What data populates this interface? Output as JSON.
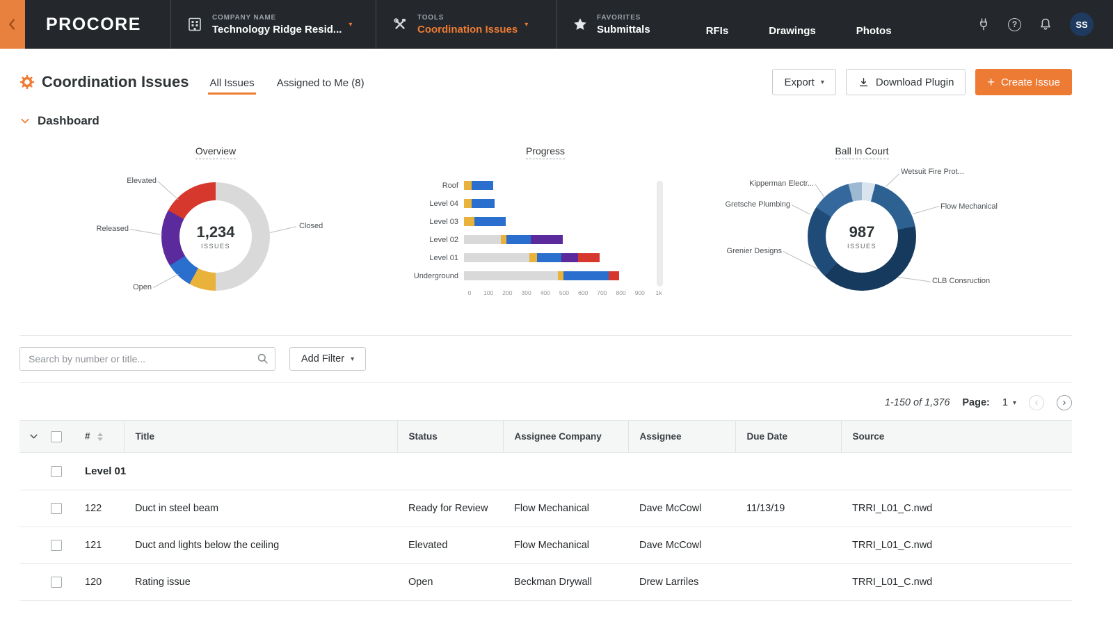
{
  "navbar": {
    "logo": "PROCORE",
    "company": {
      "label": "COMPANY NAME",
      "value": "Technology Ridge Resid..."
    },
    "tools": {
      "label": "TOOLS",
      "value": "Coordination Issues"
    },
    "favorites": {
      "label": "FAVORITES",
      "value": "Submittals"
    },
    "links": [
      "RFIs",
      "Drawings",
      "Photos"
    ],
    "avatar": "SS"
  },
  "header": {
    "title": "Coordination Issues",
    "tabs": {
      "all": "All Issues",
      "assigned": "Assigned to Me (8)"
    },
    "export_label": "Export",
    "download_label": "Download Plugin",
    "create_plus": "+",
    "create_label": "Create Issue"
  },
  "dashboard": {
    "label": "Dashboard",
    "overview": {
      "title": "Overview",
      "total": "1,234",
      "unit": "ISSUES",
      "segments": [
        {
          "color": "#d9d9d9",
          "value": 50
        },
        {
          "color": "#e9b23b",
          "value": 8
        },
        {
          "color": "#2a6fce",
          "value": 8
        },
        {
          "color": "#5b2a9d",
          "value": 17
        },
        {
          "color": "#d6382e",
          "value": 17
        }
      ],
      "callouts": {
        "elevated": "Elevated",
        "released": "Released",
        "open": "Open",
        "closed": "Closed"
      }
    },
    "progress": {
      "title": "Progress",
      "max": 1000,
      "rows": [
        {
          "label": "Roof",
          "segments": [
            {
              "color": "#e9b23b",
              "value": 40
            },
            {
              "color": "#2a6fce",
              "value": 115
            }
          ]
        },
        {
          "label": "Level 04",
          "segments": [
            {
              "color": "#e9b23b",
              "value": 40
            },
            {
              "color": "#2a6fce",
              "value": 120
            }
          ]
        },
        {
          "label": "Level 03",
          "segments": [
            {
              "color": "#e9b23b",
              "value": 55
            },
            {
              "color": "#2a6fce",
              "value": 165
            }
          ]
        },
        {
          "label": "Level 02",
          "segments": [
            {
              "color": "#d9d9d9",
              "value": 195
            },
            {
              "color": "#e9b23b",
              "value": 30
            },
            {
              "color": "#2a6fce",
              "value": 130
            },
            {
              "color": "#5b2a9d",
              "value": 170
            }
          ]
        },
        {
          "label": "Level 01",
          "segments": [
            {
              "color": "#d9d9d9",
              "value": 345
            },
            {
              "color": "#e9b23b",
              "value": 40
            },
            {
              "color": "#2a6fce",
              "value": 130
            },
            {
              "color": "#5b2a9d",
              "value": 90
            },
            {
              "color": "#d6382e",
              "value": 115
            }
          ]
        },
        {
          "label": "Underground",
          "segments": [
            {
              "color": "#d9d9d9",
              "value": 495
            },
            {
              "color": "#e9b23b",
              "value": 30
            },
            {
              "color": "#2a6fce",
              "value": 240
            },
            {
              "color": "#d6382e",
              "value": 55
            }
          ]
        }
      ],
      "ticks": [
        "0",
        "100",
        "200",
        "300",
        "400",
        "500",
        "600",
        "700",
        "800",
        "900",
        "1k"
      ]
    },
    "ball": {
      "title": "Ball In Court",
      "total": "987",
      "unit": "ISSUES",
      "segments": [
        {
          "color": "#d9e4ee",
          "value": 4
        },
        {
          "color": "#2d6191",
          "value": 18
        },
        {
          "color": "#163a5e",
          "value": 40
        },
        {
          "color": "#1f4b78",
          "value": 22
        },
        {
          "color": "#35689c",
          "value": 12
        },
        {
          "color": "#9db9d2",
          "value": 4
        }
      ],
      "callouts": {
        "kipperman": "Kipperman Electr...",
        "gretsche": "Gretsche Plumbing",
        "grenier": "Grenier Designs",
        "wetsuit": "Wetsuit Fire Prot...",
        "flow": "Flow Mechanical",
        "clb": "CLB Consruction"
      }
    }
  },
  "filter_bar": {
    "search_placeholder": "Search by number or title...",
    "add_filter_label": "Add Filter"
  },
  "pagination": {
    "range": "1-150 of 1,376",
    "page_label": "Page:",
    "current_page": "1"
  },
  "table": {
    "columns": {
      "num": "#",
      "title": "Title",
      "status": "Status",
      "company": "Assignee Company",
      "assignee": "Assignee",
      "due": "Due Date",
      "source": "Source"
    },
    "group_label": "Level 01",
    "rows": [
      {
        "num": "122",
        "title": "Duct in steel beam",
        "status": "Ready for Review",
        "company": "Flow Mechanical",
        "assignee": "Dave McCowl",
        "due": "11/13/19",
        "source": "TRRI_L01_C.nwd"
      },
      {
        "num": "121",
        "title": "Duct and lights below the ceiling",
        "status": "Elevated",
        "company": "Flow Mechanical",
        "assignee": "Dave McCowl",
        "due": "",
        "source": "TRRI_L01_C.nwd"
      },
      {
        "num": "120",
        "title": "Rating issue",
        "status": "Open",
        "company": "Beckman Drywall",
        "assignee": "Drew Larriles",
        "due": "",
        "source": "TRRI_L01_C.nwd"
      }
    ]
  },
  "colors": {
    "accent_orange": "#ee7b33",
    "navbar_bg": "#24282c",
    "avatar_bg": "#1e3a5f"
  }
}
